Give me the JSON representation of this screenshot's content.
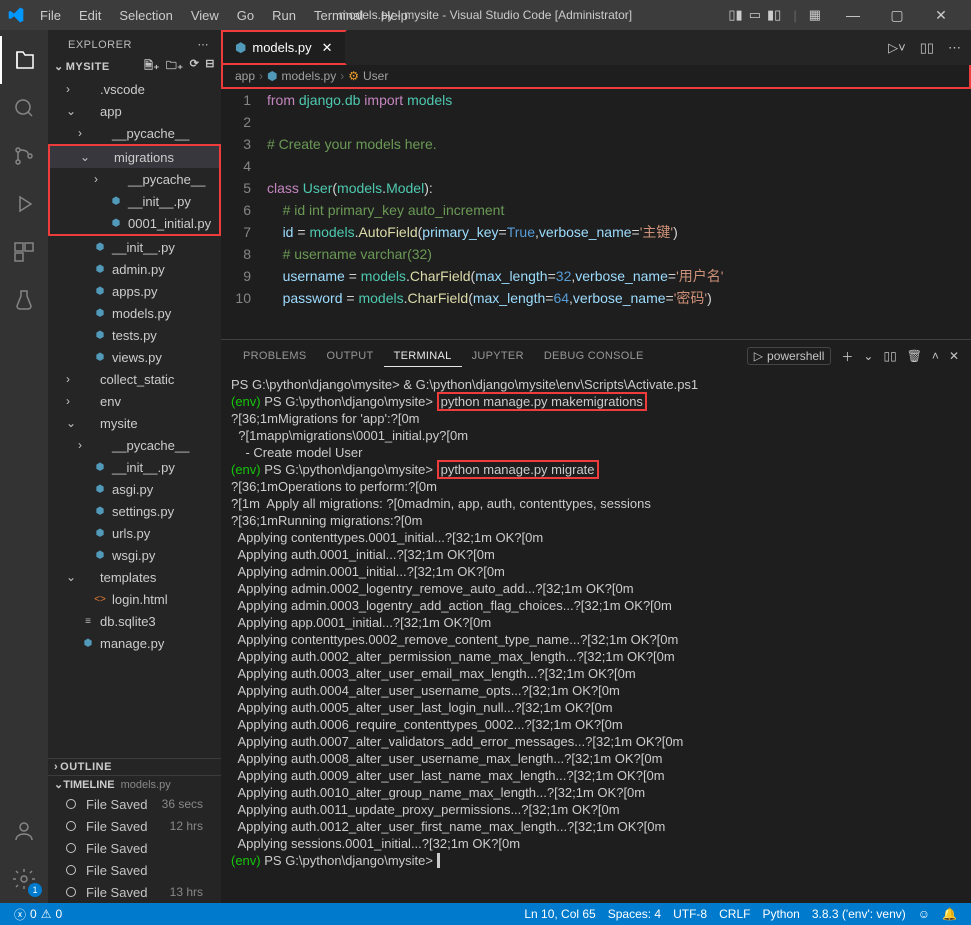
{
  "title": "models.py - mysite - Visual Studio Code [Administrator]",
  "menu": [
    "File",
    "Edit",
    "Selection",
    "View",
    "Go",
    "Run",
    "Terminal",
    "Help"
  ],
  "window_controls": {
    "min": "—",
    "max": "▢",
    "close": "✕"
  },
  "activity_badge": "1",
  "explorer": {
    "title": "EXPLORER"
  },
  "workspace": "MYSITE",
  "tree": [
    {
      "d": 1,
      "t": "folder-closed",
      "label": ".vscode",
      "c": "›"
    },
    {
      "d": 1,
      "t": "folder-open",
      "label": "app",
      "c": "⌄"
    },
    {
      "d": 2,
      "t": "folder-closed",
      "label": "__pycache__",
      "c": "›"
    },
    {
      "d": 2,
      "t": "folder-open",
      "label": "migrations",
      "c": "⌄",
      "hl": true,
      "sel": true
    },
    {
      "d": 3,
      "t": "folder-closed",
      "label": "__pycache__",
      "c": "›",
      "hl": true
    },
    {
      "d": 3,
      "t": "py",
      "label": "__init__.py",
      "hl": true
    },
    {
      "d": 3,
      "t": "py",
      "label": "0001_initial.py",
      "hl": true
    },
    {
      "d": 2,
      "t": "py",
      "label": "__init__.py"
    },
    {
      "d": 2,
      "t": "py",
      "label": "admin.py"
    },
    {
      "d": 2,
      "t": "py",
      "label": "apps.py"
    },
    {
      "d": 2,
      "t": "py",
      "label": "models.py"
    },
    {
      "d": 2,
      "t": "py",
      "label": "tests.py"
    },
    {
      "d": 2,
      "t": "py",
      "label": "views.py"
    },
    {
      "d": 1,
      "t": "folder-closed",
      "label": "collect_static",
      "c": "›"
    },
    {
      "d": 1,
      "t": "folder-closed",
      "label": "env",
      "c": "›"
    },
    {
      "d": 1,
      "t": "folder-open",
      "label": "mysite",
      "c": "⌄"
    },
    {
      "d": 2,
      "t": "folder-closed",
      "label": "__pycache__",
      "c": "›"
    },
    {
      "d": 2,
      "t": "py",
      "label": "__init__.py"
    },
    {
      "d": 2,
      "t": "py",
      "label": "asgi.py"
    },
    {
      "d": 2,
      "t": "py",
      "label": "settings.py"
    },
    {
      "d": 2,
      "t": "py",
      "label": "urls.py"
    },
    {
      "d": 2,
      "t": "py",
      "label": "wsgi.py"
    },
    {
      "d": 1,
      "t": "folder-open",
      "label": "templates",
      "c": "⌄"
    },
    {
      "d": 2,
      "t": "html",
      "label": "login.html"
    },
    {
      "d": 1,
      "t": "db",
      "label": "db.sqlite3"
    },
    {
      "d": 1,
      "t": "py",
      "label": "manage.py"
    }
  ],
  "outline_label": "OUTLINE",
  "timeline": {
    "label": "TIMELINE",
    "subtitle": "models.py",
    "items": [
      {
        "label": "File Saved",
        "time": "36 secs"
      },
      {
        "label": "File Saved",
        "time": "12 hrs"
      },
      {
        "label": "File Saved",
        "time": ""
      },
      {
        "label": "File Saved",
        "time": ""
      },
      {
        "label": "File Saved",
        "time": "13 hrs"
      }
    ]
  },
  "tab": {
    "icon": "py",
    "label": "models.py",
    "dirty": true
  },
  "breadcrumb": [
    "app",
    "models.py",
    "User"
  ],
  "breadcrumb_class_icon": "⚙",
  "code": {
    "lines": [
      {
        "n": 1,
        "html": "<span class='kw'>from</span> <span class='cls'>django.db</span> <span class='kw'>import</span> <span class='cls'>models</span>"
      },
      {
        "n": 2,
        "html": ""
      },
      {
        "n": 3,
        "html": "<span class='cmt'># Create your models here.</span>"
      },
      {
        "n": 4,
        "html": ""
      },
      {
        "n": 5,
        "html": "<span class='kw'>class</span> <span class='cls'>User</span><span class='p'>(</span><span class='cls'>models</span><span class='p'>.</span><span class='cls'>Model</span><span class='p'>):</span>"
      },
      {
        "n": 6,
        "html": "    <span class='cmt'># id int primary_key auto_increment</span>"
      },
      {
        "n": 7,
        "html": "    <span class='var'>id</span> <span class='p'>=</span> <span class='cls'>models</span><span class='p'>.</span><span class='fn'>AutoField</span><span class='p'>(</span><span class='arg'>primary_key</span><span class='p'>=</span><span class='num'>True</span><span class='p'>,</span><span class='arg'>verbose_name</span><span class='p'>=</span><span class='str'>'主键'</span><span class='p'>)</span>"
      },
      {
        "n": 8,
        "html": "    <span class='cmt'># username varchar(32)</span>"
      },
      {
        "n": 9,
        "html": "    <span class='var'>username</span> <span class='p'>=</span> <span class='cls'>models</span><span class='p'>.</span><span class='fn'>CharField</span><span class='p'>(</span><span class='arg'>max_length</span><span class='p'>=</span><span class='num'>32</span><span class='p'>,</span><span class='arg'>verbose_name</span><span class='p'>=</span><span class='str'>'用户名'</span>"
      },
      {
        "n": 10,
        "html": "    <span class='var'>password</span> <span class='p'>=</span> <span class='cls'>models</span><span class='p'>.</span><span class='fn'>CharField</span><span class='p'>(</span><span class='arg'>max_length</span><span class='p'>=</span><span class='num'>64</span><span class='p'>,</span><span class='arg'>verbose_name</span><span class='p'>=</span><span class='str'>'密码'</span><span class='p'>)</span>"
      }
    ]
  },
  "panel": {
    "tabs": [
      "PROBLEMS",
      "OUTPUT",
      "TERMINAL",
      "JUPYTER",
      "DEBUG CONSOLE"
    ],
    "active": 2,
    "shell": "powershell"
  },
  "terminal": [
    "PS G:\\python\\django\\mysite> & G:\\python\\django\\mysite\\env\\Scripts\\Activate.ps1",
    {
      "env": "(env) ",
      "t": "PS G:\\python\\django\\mysite> ",
      "cmd": "python manage.py makemigrations",
      "hl": true
    },
    "?[36;1mMigrations for 'app':?[0m",
    "  ?[1mapp\\migrations\\0001_initial.py?[0m",
    "    - Create model User",
    {
      "env": "(env) ",
      "t": "PS G:\\python\\django\\mysite> ",
      "cmd": "python manage.py migrate",
      "hl": true
    },
    "?[36;1mOperations to perform:?[0m",
    "?[1m  Apply all migrations: ?[0madmin, app, auth, contenttypes, sessions",
    "?[36;1mRunning migrations:?[0m",
    "  Applying contenttypes.0001_initial...?[32;1m OK?[0m",
    "  Applying auth.0001_initial...?[32;1m OK?[0m",
    "  Applying admin.0001_initial...?[32;1m OK?[0m",
    "  Applying admin.0002_logentry_remove_auto_add...?[32;1m OK?[0m",
    "  Applying admin.0003_logentry_add_action_flag_choices...?[32;1m OK?[0m",
    "  Applying app.0001_initial...?[32;1m OK?[0m",
    "  Applying contenttypes.0002_remove_content_type_name...?[32;1m OK?[0m",
    "  Applying auth.0002_alter_permission_name_max_length...?[32;1m OK?[0m",
    "  Applying auth.0003_alter_user_email_max_length...?[32;1m OK?[0m",
    "  Applying auth.0004_alter_user_username_opts...?[32;1m OK?[0m",
    "  Applying auth.0005_alter_user_last_login_null...?[32;1m OK?[0m",
    "  Applying auth.0006_require_contenttypes_0002...?[32;1m OK?[0m",
    "  Applying auth.0007_alter_validators_add_error_messages...?[32;1m OK?[0m",
    "  Applying auth.0008_alter_user_username_max_length...?[32;1m OK?[0m",
    "  Applying auth.0009_alter_user_last_name_max_length...?[32;1m OK?[0m",
    "  Applying auth.0010_alter_group_name_max_length...?[32;1m OK?[0m",
    "  Applying auth.0011_update_proxy_permissions...?[32;1m OK?[0m",
    "  Applying auth.0012_alter_user_first_name_max_length...?[32;1m OK?[0m",
    "  Applying sessions.0001_initial...?[32;1m OK?[0m",
    {
      "env": "(env) ",
      "t": "PS G:\\python\\django\\mysite> ",
      "cursor": true
    }
  ],
  "status": {
    "errors": "0",
    "warnings": "0",
    "lncol": "Ln 10, Col 65",
    "spaces": "Spaces: 4",
    "encoding": "UTF-8",
    "eol": "CRLF",
    "lang": "Python",
    "interp": "3.8.3 ('env': venv)"
  }
}
